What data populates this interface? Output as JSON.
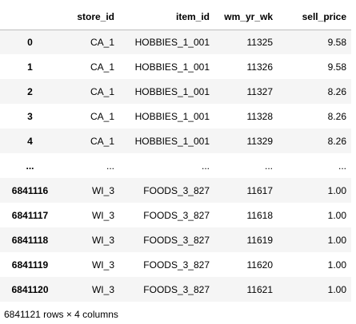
{
  "table": {
    "columns": [
      "store_id",
      "item_id",
      "wm_yr_wk",
      "sell_price"
    ],
    "rows": [
      {
        "index": "0",
        "cells": [
          "CA_1",
          "HOBBIES_1_001",
          "11325",
          "9.58"
        ]
      },
      {
        "index": "1",
        "cells": [
          "CA_1",
          "HOBBIES_1_001",
          "11326",
          "9.58"
        ]
      },
      {
        "index": "2",
        "cells": [
          "CA_1",
          "HOBBIES_1_001",
          "11327",
          "8.26"
        ]
      },
      {
        "index": "3",
        "cells": [
          "CA_1",
          "HOBBIES_1_001",
          "11328",
          "8.26"
        ]
      },
      {
        "index": "4",
        "cells": [
          "CA_1",
          "HOBBIES_1_001",
          "11329",
          "8.26"
        ]
      },
      {
        "index": "...",
        "cells": [
          "...",
          "...",
          "...",
          "..."
        ]
      },
      {
        "index": "6841116",
        "cells": [
          "WI_3",
          "FOODS_3_827",
          "11617",
          "1.00"
        ]
      },
      {
        "index": "6841117",
        "cells": [
          "WI_3",
          "FOODS_3_827",
          "11618",
          "1.00"
        ]
      },
      {
        "index": "6841118",
        "cells": [
          "WI_3",
          "FOODS_3_827",
          "11619",
          "1.00"
        ]
      },
      {
        "index": "6841119",
        "cells": [
          "WI_3",
          "FOODS_3_827",
          "11620",
          "1.00"
        ]
      },
      {
        "index": "6841120",
        "cells": [
          "WI_3",
          "FOODS_3_827",
          "11621",
          "1.00"
        ]
      }
    ],
    "shape_text": "6841121 rows × 4 columns"
  }
}
